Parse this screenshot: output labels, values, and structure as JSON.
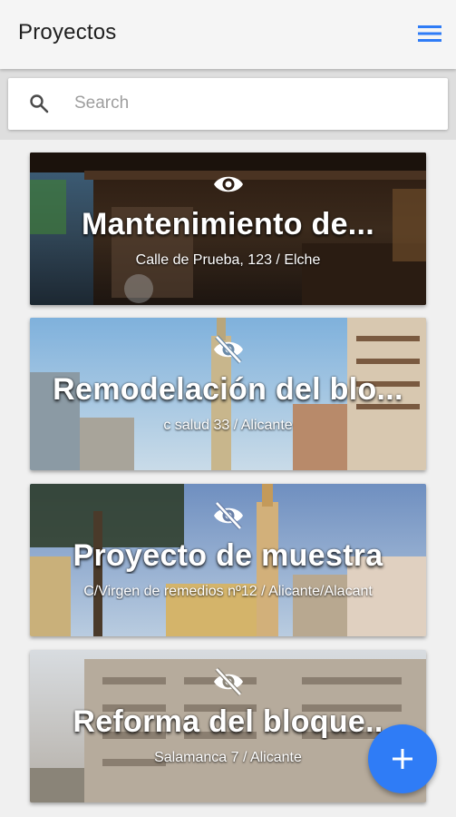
{
  "app": {
    "title": "Proyectos",
    "menu_icon": "hamburger-menu-icon",
    "accent_color": "#2f7cf6"
  },
  "search": {
    "placeholder": "Search",
    "icon": "search-icon"
  },
  "projects": [
    {
      "title": "Mantenimiento de...",
      "address": "Calle de Prueba, 123 / Elche",
      "visibility_icon": "eye-icon",
      "visible": true
    },
    {
      "title": "Remodelación del blo...",
      "address": "c salud 33 / Alicante",
      "visibility_icon": "eye-off-icon",
      "visible": false
    },
    {
      "title": "Proyecto de muestra",
      "address": "C/Virgen de remedios nº12 / Alicante/Alacant",
      "visibility_icon": "eye-off-icon",
      "visible": false
    },
    {
      "title": "Reforma del bloque..",
      "address": "Salamanca 7 / Alicante",
      "visibility_icon": "eye-off-icon",
      "visible": false
    }
  ],
  "fab": {
    "icon": "plus-icon",
    "color": "#2f7cf6"
  }
}
